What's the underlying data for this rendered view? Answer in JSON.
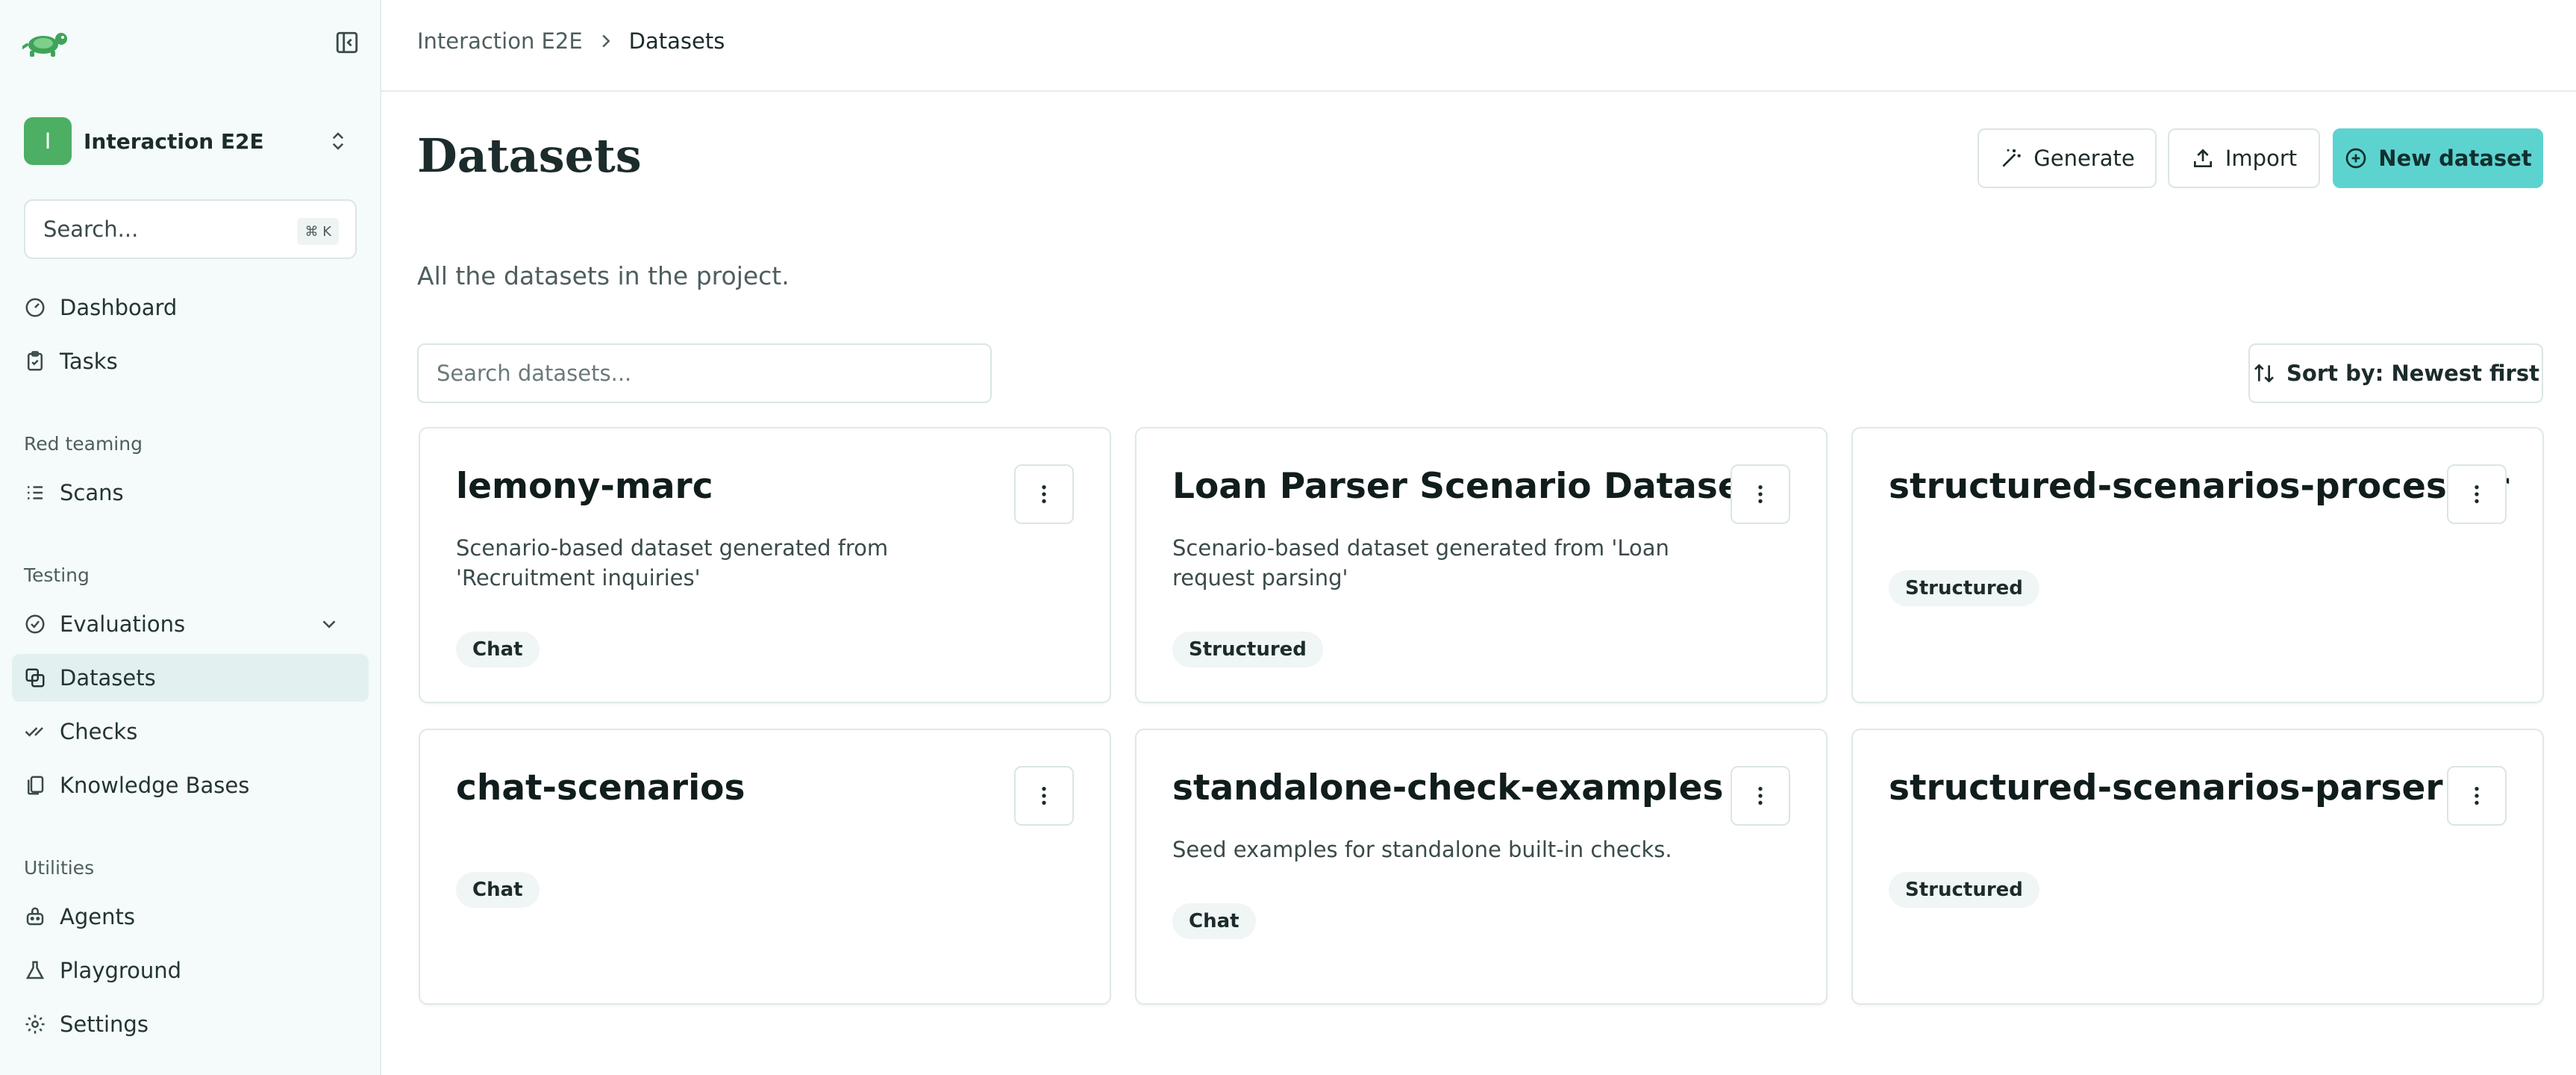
{
  "sidebar": {
    "logo_icon": "turtle-logo-icon",
    "project": {
      "initial": "I",
      "name": "Interaction E2E",
      "accent": "#4caf63"
    },
    "search": {
      "placeholder": "Search...",
      "shortcut": "⌘ K"
    },
    "items": {
      "dashboard": "Dashboard",
      "tasks": "Tasks",
      "scans": "Scans",
      "evaluations": "Evaluations",
      "datasets": "Datasets",
      "checks": "Checks",
      "knowledge_bases": "Knowledge Bases",
      "agents": "Agents",
      "playground": "Playground",
      "settings": "Settings"
    },
    "sections": {
      "red_teaming": "Red teaming",
      "testing": "Testing",
      "utilities": "Utilities"
    },
    "active_item": "Datasets"
  },
  "header": {
    "breadcrumb": [
      "Interaction E2E",
      "Datasets"
    ]
  },
  "main": {
    "title": "Datasets",
    "subtitle": "All the datasets in the project.",
    "actions": {
      "generate": "Generate",
      "import": "Import",
      "new_dataset": "New dataset"
    },
    "search_placeholder": "Search datasets...",
    "sort_label": "Sort by: Newest first",
    "accent_color": "#5dd3cf",
    "datasets": [
      {
        "title": "lemony-marc",
        "description": "Scenario-based dataset generated from 'Recruitment inquiries'",
        "type": "Chat"
      },
      {
        "title": "Loan Parser Scenario Dataset",
        "description": "Scenario-based dataset generated from 'Loan request parsing'",
        "type": "Structured"
      },
      {
        "title": "structured-scenarios-processor",
        "description": "",
        "type": "Structured"
      },
      {
        "title": "chat-scenarios",
        "description": "",
        "type": "Chat"
      },
      {
        "title": "standalone-check-examples",
        "description": "Seed examples for standalone built-in checks.",
        "type": "Chat"
      },
      {
        "title": "structured-scenarios-parser",
        "description": "",
        "type": "Structured"
      }
    ]
  }
}
